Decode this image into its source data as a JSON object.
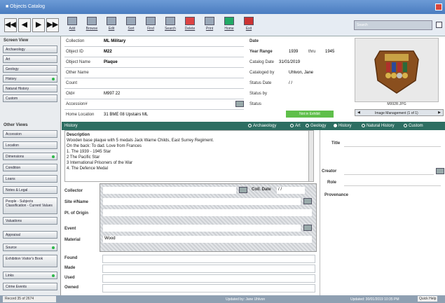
{
  "window": {
    "title": "■ Objects Catalog"
  },
  "toolbar": {
    "nav": [
      "◀◀",
      "◀",
      "▶",
      "▶▶"
    ],
    "buttons": [
      {
        "label": "Add"
      },
      {
        "label": "Browse"
      },
      {
        "label": "Edit"
      },
      {
        "label": "Sort"
      },
      {
        "label": "Find"
      },
      {
        "label": "Search"
      },
      {
        "label": "Delete"
      },
      {
        "label": "Print"
      },
      {
        "label": "Home"
      },
      {
        "label": "Exit"
      }
    ],
    "search_placeholder": "Search"
  },
  "sidebar": {
    "screen_view_label": "Screen View",
    "screen_items": [
      "Archaeology",
      "Art",
      "Geology",
      "History",
      "Natural History",
      "Custom"
    ],
    "other_views_label": "Other Views",
    "other_items": [
      "Accession",
      "Location",
      "Dimensions",
      "Condition",
      "Loans",
      "Notes & Legal",
      "People - Subjects Classification - Current Values",
      "Valuations",
      "Appraisal",
      "Source",
      "Exhibition Visitor's Book",
      "Links",
      "Crime Events"
    ],
    "record_status": "Record 35 of 2674"
  },
  "record": {
    "collection_label": "Collection",
    "collection": "ML Military",
    "object_id_label": "Object ID",
    "object_id": "M22",
    "object_name_label": "Object Name",
    "object_name": "Plaque",
    "other_name_label": "Other Name",
    "other_name": "",
    "count_label": "Count",
    "count": "",
    "old_label": "Old#",
    "old_number": "M997 22",
    "accession_label": "Accession#",
    "accession": "",
    "home_location_label": "Home Location",
    "home_location": "31 BME 08 Upstairs ML"
  },
  "date_panel": {
    "date_label": "Date",
    "year_range_label": "Year Range",
    "year_from": "1939",
    "year_sep": "thru",
    "year_to": "1945",
    "catalog_date_label": "Catalog Date",
    "catalog_date": "31/01/2019",
    "cataloged_by_label": "Cataloged by",
    "cataloged_by": "Uhlvon, Jane",
    "status_date_label": "Status Date",
    "status_date": "/ /",
    "status_by_label": "Status by",
    "status_by": "",
    "status_label": "Status",
    "status": "",
    "green_button": "Not in Exhibit"
  },
  "image": {
    "caption": "M992R.JPG",
    "manager": "Image Management (1 of 1)"
  },
  "history": {
    "title": "History",
    "views": [
      "Archaeology",
      "Art",
      "Geology",
      "History",
      "Natural History",
      "Custom"
    ],
    "selected": "History",
    "description_label": "Description",
    "description_lines": [
      "Wooden base plaque with 5 medals Jack Warne Childs, East Surrey Regiment.",
      "On the back: To dad. Love from Frances",
      "1. The 1939 - 1945 Star",
      "2 The Pacific Star",
      "3 International Prisoners of the War",
      "4. The Defence Medal"
    ]
  },
  "lower": {
    "collector_label": "Collector",
    "coll_date_label": "Coll. Date",
    "coll_date": "/ /",
    "site_label": "Site #/Name",
    "origin_label": "Pl. of Origin",
    "event_label": "Event",
    "material_label": "Material",
    "material": "Wood",
    "found_label": "Found",
    "made_label": "Made",
    "used_label": "Used",
    "owned_label": "Owned"
  },
  "right_panel": {
    "title_label": "Title",
    "creator_label": "Creator",
    "role_label": "Role",
    "provenance_label": "Provenance"
  },
  "statusbar": {
    "updated_by": "Updated by: Jane Uhlvon",
    "updated": "Updated: 30/01/2019 10:35 PM",
    "quick_label": "Quick Help"
  }
}
